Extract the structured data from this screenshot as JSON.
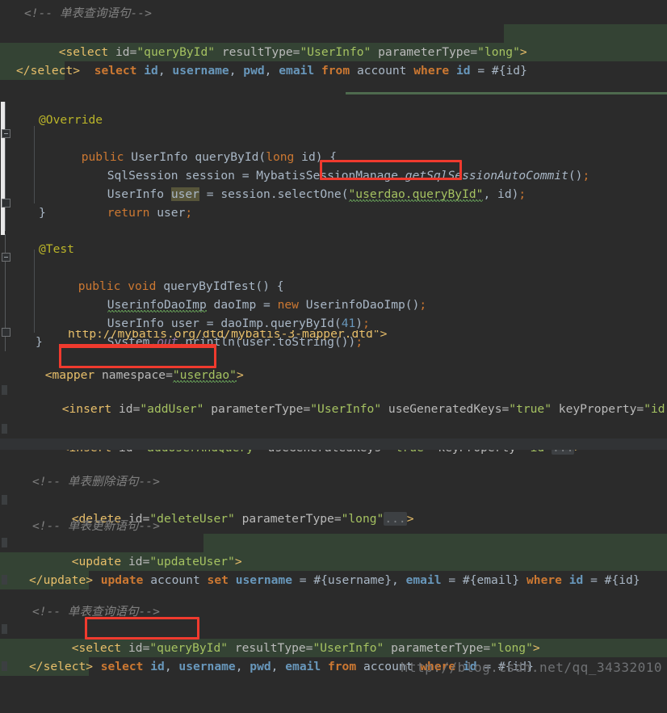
{
  "app": {
    "theme_bg": "#2b2b2b",
    "highlight_color": "#344334",
    "annotation_color": "#f03a2e",
    "watermark": "http://blog.csdn.net/qq_34332010"
  },
  "panes": {
    "top_xml": {
      "name": "mapper-xml-top",
      "lines": [
        {
          "comment": "<!-- 单表查询语句-->"
        },
        {
          "tag_open": "<select ",
          "attr1": "id=",
          "v1": "\"queryById\"",
          "attr2": " resultType=",
          "v2": "\"UserInfo\"",
          "attr3": " parameterType=",
          "v3": "\"long\"",
          "tag_close": ">"
        },
        {
          "sql": "select id, username, pwd, email from account where id = #{id}"
        },
        {
          "tag_end": "</select>"
        }
      ]
    },
    "java_impl": {
      "name": "dao-implementation",
      "lines": [
        "@Override",
        "public UserInfo queryById(long id) {",
        "    SqlSession session = MybatisSessionManage.getSqlSessionAutoCommit();",
        "    UserInfo user = session.selectOne(\"userdao.queryById\", id);",
        "    return user;",
        "}"
      ],
      "annotation": "userdao.queryById"
    },
    "java_test": {
      "name": "junit-test-method",
      "lines": [
        "@Test",
        "public void queryByIdTest() {",
        "    UserinfoDaoImp daoImp = new UserinfoDaoImp();",
        "    UserInfo user = daoImp.queryById(41);",
        "    System.out.println(user.toString());",
        "}"
      ],
      "id_value": "41"
    },
    "mapper_xml": {
      "name": "mapper-xml-body",
      "dtd_partial": "http://mybatis.org/dtd/mybatis-3-mapper.dtd\">",
      "mapper_tag": "<mapper ",
      "mapper_attr": "namespace=",
      "mapper_value": "\"userdao\"",
      "mapper_close": ">",
      "insert1": {
        "tag": "<insert ",
        "a1": "id=",
        "v1": "\"addUser\"",
        "a2": " parameterType=",
        "v2": "\"UserInfo\"",
        "a3": " useGeneratedKeys=",
        "v3": "\"true\"",
        "a4": " keyProperty=",
        "v4": "\"id\"",
        "fold": "..."
      },
      "insert2": {
        "tag": "<insert ",
        "a1": "id=",
        "v1": "\"addUserAndQuery\"",
        "a2": " useGeneratedKeys=",
        "v2": "\"true\"",
        "a3": " keyProperty=",
        "v3": "\"id\"",
        "fold": "...",
        "close": ">"
      },
      "delete_comment": "<!-- 单表删除语句-->",
      "delete": {
        "tag": "<delete ",
        "a1": "id=",
        "v1": "\"deleteUser\"",
        "a2": " parameterType=",
        "v2": "\"long\"",
        "fold": "...",
        "close": ">"
      },
      "update_comment": "<!-- 单表更新语句-->",
      "update_open_tag": "<update ",
      "update_attr": "id=",
      "update_value": "\"updateUser\"",
      "update_close": ">",
      "update_sql": "update account set username = #{username}, email = #{email} where id = #{id}",
      "update_end": "</update>",
      "select_comment": "<!-- 单表查询语句-->",
      "select_open_tag": "<select ",
      "select_attr_id": "id=",
      "select_value_id": "\"queryById\"",
      "select_attr_rt": " resultType=",
      "select_value_rt": "\"UserInfo\"",
      "select_attr_pt": " parameterType=",
      "select_value_pt": "\"long\"",
      "select_close": ">",
      "select_sql": "select id, username, pwd, email from account where id = #{id}",
      "select_end": "</select>"
    }
  },
  "sql_tokens": {
    "select": "select",
    "from": "from",
    "where": "where",
    "update": "update",
    "set": "set",
    "id": "id",
    "username": "username",
    "pwd": "pwd",
    "email": "email",
    "account": "account",
    "comma": ",",
    "eq": " = ",
    "param_id": "#{id}",
    "param_username": "#{username}",
    "param_email": "#{email}"
  },
  "java_tokens": {
    "override": "@Override",
    "test": "@Test",
    "public": "public",
    "void": "void",
    "new": "new",
    "return": "return",
    "long": "long",
    "UserInfo": "UserInfo",
    "queryById": "queryById",
    "id": "id",
    "SqlSession": "SqlSession",
    "session": "session",
    "MybatisSessionManage": "MybatisSessionManage",
    "getSqlSessionAutoCommit": "getSqlSessionAutoCommit",
    "user": "user",
    "selectOne": "selectOne",
    "userdao_queryById": "\"userdao.queryById\"",
    "queryByIdTest": "queryByIdTest",
    "UserinfoDaoImp": "UserinfoDaoImp",
    "daoImp": "daoImp",
    "num41": "41",
    "System": "System",
    "out": "out",
    "println": "println",
    "toString": "toString"
  }
}
